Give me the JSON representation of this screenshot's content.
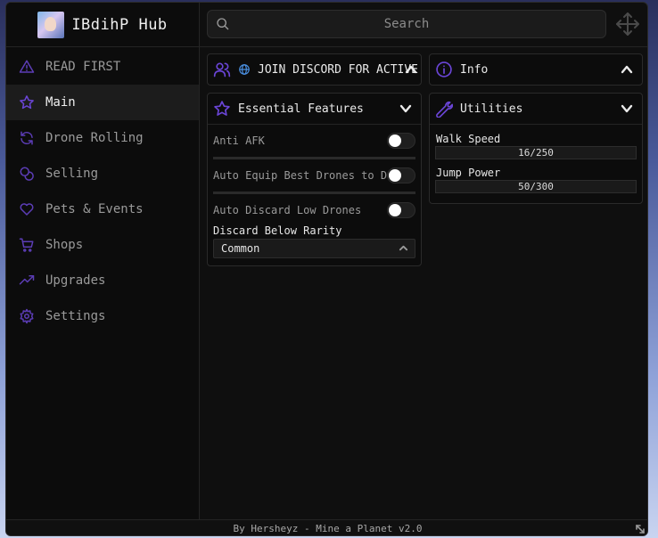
{
  "app": {
    "title": "IBdihP Hub",
    "avatar_icon": "avatar-image"
  },
  "search": {
    "placeholder": "Search"
  },
  "sidebar": {
    "items": [
      {
        "label": "READ FIRST",
        "icon": "warning-triangle-icon"
      },
      {
        "label": "Main",
        "icon": "star-icon",
        "active": true
      },
      {
        "label": "Drone Rolling",
        "icon": "refresh-icon"
      },
      {
        "label": "Selling",
        "icon": "coins-icon"
      },
      {
        "label": "Pets & Events",
        "icon": "heart-icon"
      },
      {
        "label": "Shops",
        "icon": "cart-icon"
      },
      {
        "label": "Upgrades",
        "icon": "trending-up-icon"
      },
      {
        "label": "Settings",
        "icon": "gear-icon"
      }
    ]
  },
  "cards": {
    "discord": {
      "title": "JOIN DISCORD FOR ACTIVE"
    },
    "info": {
      "title": "Info"
    },
    "essential": {
      "title": "Essential Features",
      "toggles": [
        {
          "label": "Anti AFK",
          "value": false
        },
        {
          "label": "Auto Equip Best Drones to Do",
          "value": false
        },
        {
          "label": "Auto Discard Low Drones",
          "value": false
        }
      ],
      "dropdown": {
        "label": "Discard Below Rarity",
        "value": "Common"
      }
    },
    "utilities": {
      "title": "Utilities",
      "sliders": [
        {
          "label": "Walk Speed",
          "value": "16/250"
        },
        {
          "label": "Jump Power",
          "value": "50/300"
        }
      ]
    }
  },
  "footer": {
    "text": "By Hersheyz - Mine a Planet v2.0"
  },
  "colors": {
    "accent": "#6a45d6",
    "window_bg": "#0f0f0f",
    "panel_bg": "#0c0c0c"
  }
}
